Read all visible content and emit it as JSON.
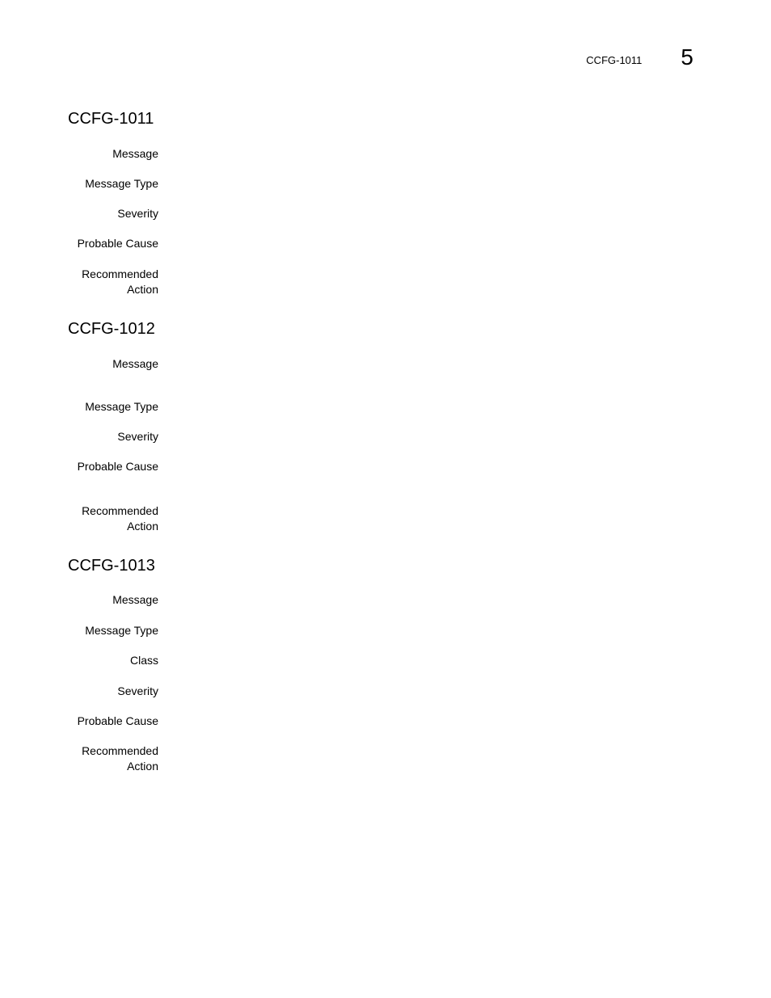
{
  "header": {
    "running_title": "CCFG-1011",
    "chapter_number": "5"
  },
  "sections": [
    {
      "title": "CCFG-1011",
      "fields": [
        {
          "label": "Message",
          "value": ""
        },
        {
          "label": "Message Type",
          "value": ""
        },
        {
          "label": "Severity",
          "value": ""
        },
        {
          "label": "Probable Cause",
          "value": ""
        },
        {
          "label": "Recommended Action",
          "value": ""
        }
      ]
    },
    {
      "title": "CCFG-1012",
      "fields": [
        {
          "label": "Message",
          "value": ""
        },
        {
          "label": "Message Type",
          "value": ""
        },
        {
          "label": "Severity",
          "value": ""
        },
        {
          "label": "Probable Cause",
          "value": ""
        },
        {
          "label": "Recommended Action",
          "value": ""
        }
      ]
    },
    {
      "title": "CCFG-1013",
      "fields": [
        {
          "label": "Message",
          "value": ""
        },
        {
          "label": "Message Type",
          "value": ""
        },
        {
          "label": "Class",
          "value": ""
        },
        {
          "label": "Severity",
          "value": ""
        },
        {
          "label": "Probable Cause",
          "value": ""
        },
        {
          "label": "Recommended Action",
          "value": ""
        }
      ]
    }
  ]
}
